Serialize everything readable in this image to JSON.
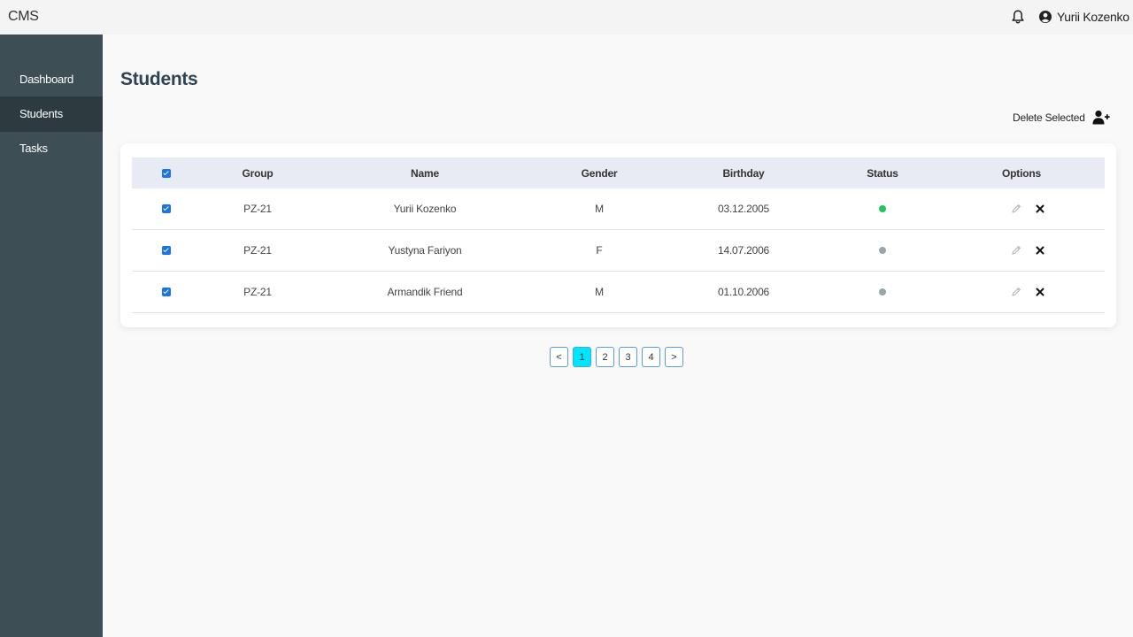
{
  "app": {
    "title": "CMS"
  },
  "header": {
    "user_name": "Yurii Kozenko"
  },
  "sidebar": {
    "items": [
      {
        "label": "Dashboard"
      },
      {
        "label": "Students"
      },
      {
        "label": "Tasks"
      }
    ],
    "active": "Students"
  },
  "page": {
    "title": "Students"
  },
  "toolbar": {
    "delete_selected_label": "Delete Selected"
  },
  "table": {
    "headers": [
      "Group",
      "Name",
      "Gender",
      "Birthday",
      "Status",
      "Options"
    ],
    "rows": [
      {
        "group": "PZ-21",
        "name": "Yurii Kozenko",
        "gender": "M",
        "birthday": "03.12.2005",
        "status": "online"
      },
      {
        "group": "PZ-21",
        "name": "Yustyna Fariyon",
        "gender": "F",
        "birthday": "14.07.2006",
        "status": "offline"
      },
      {
        "group": "PZ-21",
        "name": "Armandik Friend",
        "gender": "M",
        "birthday": "01.10.2006",
        "status": "offline"
      }
    ]
  },
  "pagination": {
    "prev_label": "<",
    "pages": [
      "1",
      "2",
      "3",
      "4"
    ],
    "current": "1",
    "next_label": ">"
  },
  "colors": {
    "sidebar": "#3d4f55",
    "sidebar_active": "#2d3b40",
    "status_online": "#22c55e",
    "status_offline": "#9aa5ab",
    "page_active": "#00e5ff"
  },
  "icons": {
    "bell": "bell-icon",
    "user": "user-circle-icon",
    "add_user": "add-user-icon",
    "edit": "pencil-icon",
    "delete": "close-icon"
  }
}
